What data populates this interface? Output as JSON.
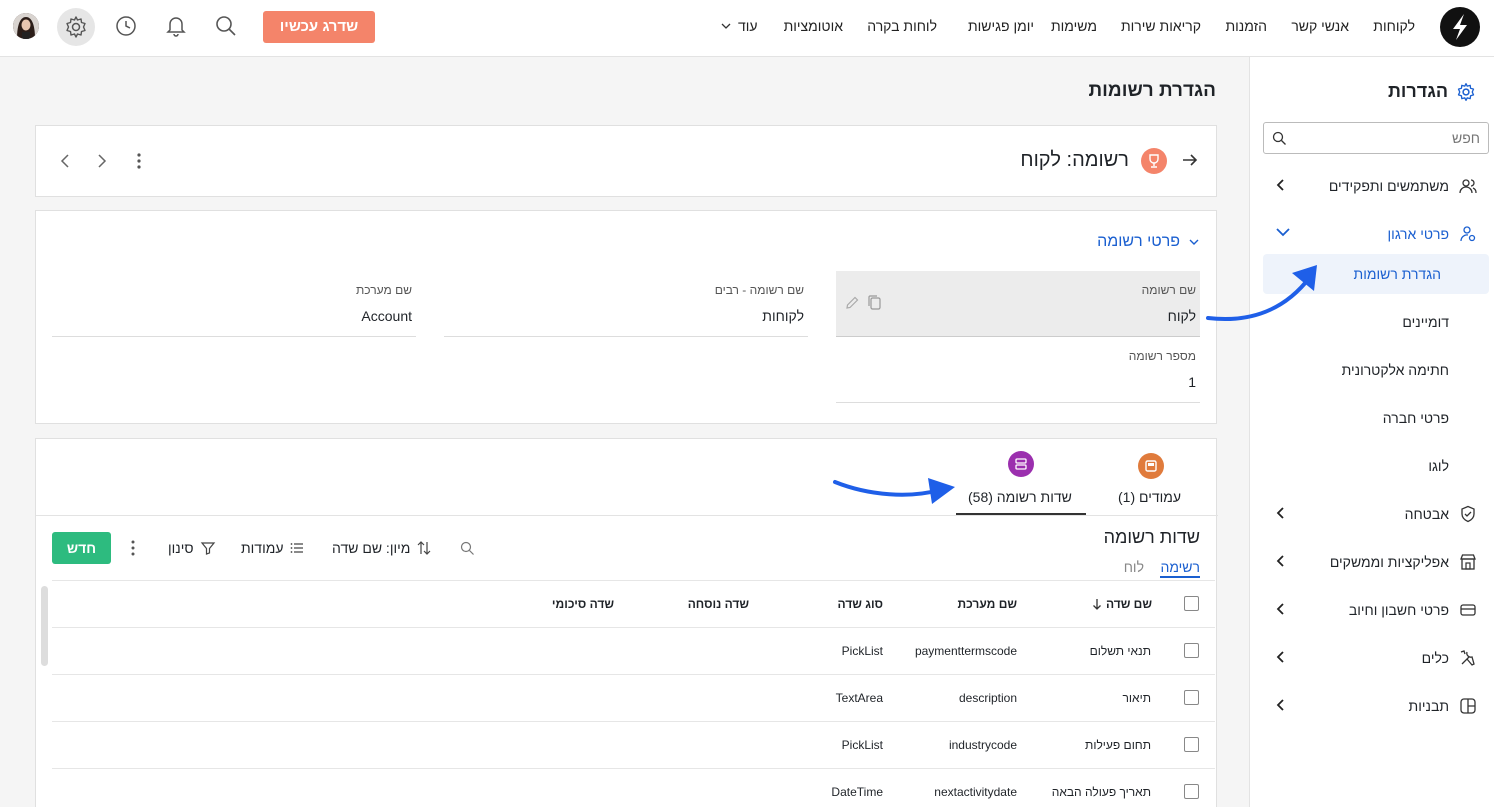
{
  "nav": {
    "items": [
      "לקוחות",
      "אנשי קשר",
      "הזמנות",
      "קריאות שירות",
      "משימות",
      "יומן פגישות",
      "לוחות בקרה",
      "אוטומציות"
    ],
    "more_label": "עוד",
    "upgrade_label": "שדרג עכשיו",
    "icons": [
      "logo-icon",
      "search-icon",
      "bell-icon",
      "history-icon",
      "gear-icon",
      "avatar"
    ]
  },
  "sidebar": {
    "title": "הגדרות",
    "search_placeholder": "חפש",
    "items": [
      {
        "label": "משתמשים ותפקידים",
        "icon": "users-icon"
      },
      {
        "label": "פרטי ארגון",
        "icon": "org-settings-icon"
      },
      {
        "label": "אבטחה",
        "icon": "shield-icon"
      },
      {
        "label": "אפליקציות וממשקים",
        "icon": "store-icon"
      },
      {
        "label": "פרטי חשבון וחיוב",
        "icon": "credit-card-icon"
      },
      {
        "label": "כלים",
        "icon": "tools-icon"
      },
      {
        "label": "תבניות",
        "icon": "templates-icon"
      }
    ],
    "sub_items": [
      "הגדרת רשומות",
      "דומיינים",
      "חתימה אלקטרונית",
      "פרטי חברה",
      "לוגו"
    ],
    "active_color": "#1a5fd0"
  },
  "page": {
    "title": "הגדרת רשומות",
    "record_title": "רשומה: לקוח"
  },
  "details": {
    "section_title": "פרטי רשומה",
    "fields": {
      "record_name_label": "שם רשומה",
      "record_name_value": "לקוח",
      "plural_label": "שם רשומה - רבים",
      "plural_value": "לקוחות",
      "system_label": "שם מערכת",
      "system_value": "Account",
      "number_label": "מספר רשומה",
      "number_value": "1"
    }
  },
  "tabs": [
    {
      "label": "עמודים (1)",
      "color": "#e07b3c"
    },
    {
      "label": "שדות רשומה (58)",
      "color": "#9b2fae"
    }
  ],
  "fields_panel": {
    "title": "שדות רשומה",
    "view_list": "רשימה",
    "view_board": "לוח",
    "new_label": "חדש",
    "filter_label": "סינון",
    "columns_label": "עמודות",
    "sort_label": "מיון: שם שדה",
    "headers": [
      "שם שדה",
      "שם מערכת",
      "סוג שדה",
      "שדה נוסחה",
      "שדה סיכומי"
    ],
    "rows": [
      {
        "name": "תנאי תשלום",
        "system": "paymenttermscode",
        "type": "PickList"
      },
      {
        "name": "תיאור",
        "system": "description",
        "type": "TextArea"
      },
      {
        "name": "תחום פעילות",
        "system": "industrycode",
        "type": "PickList"
      },
      {
        "name": "תאריך פעולה הבאה",
        "system": "nextactivitydate",
        "type": "DateTime"
      }
    ]
  },
  "colors": {
    "accent": "#1a5fd0",
    "new_button": "#2dbb7f",
    "upgrade": "#f4846a",
    "arrow": "#1f5fe8"
  }
}
